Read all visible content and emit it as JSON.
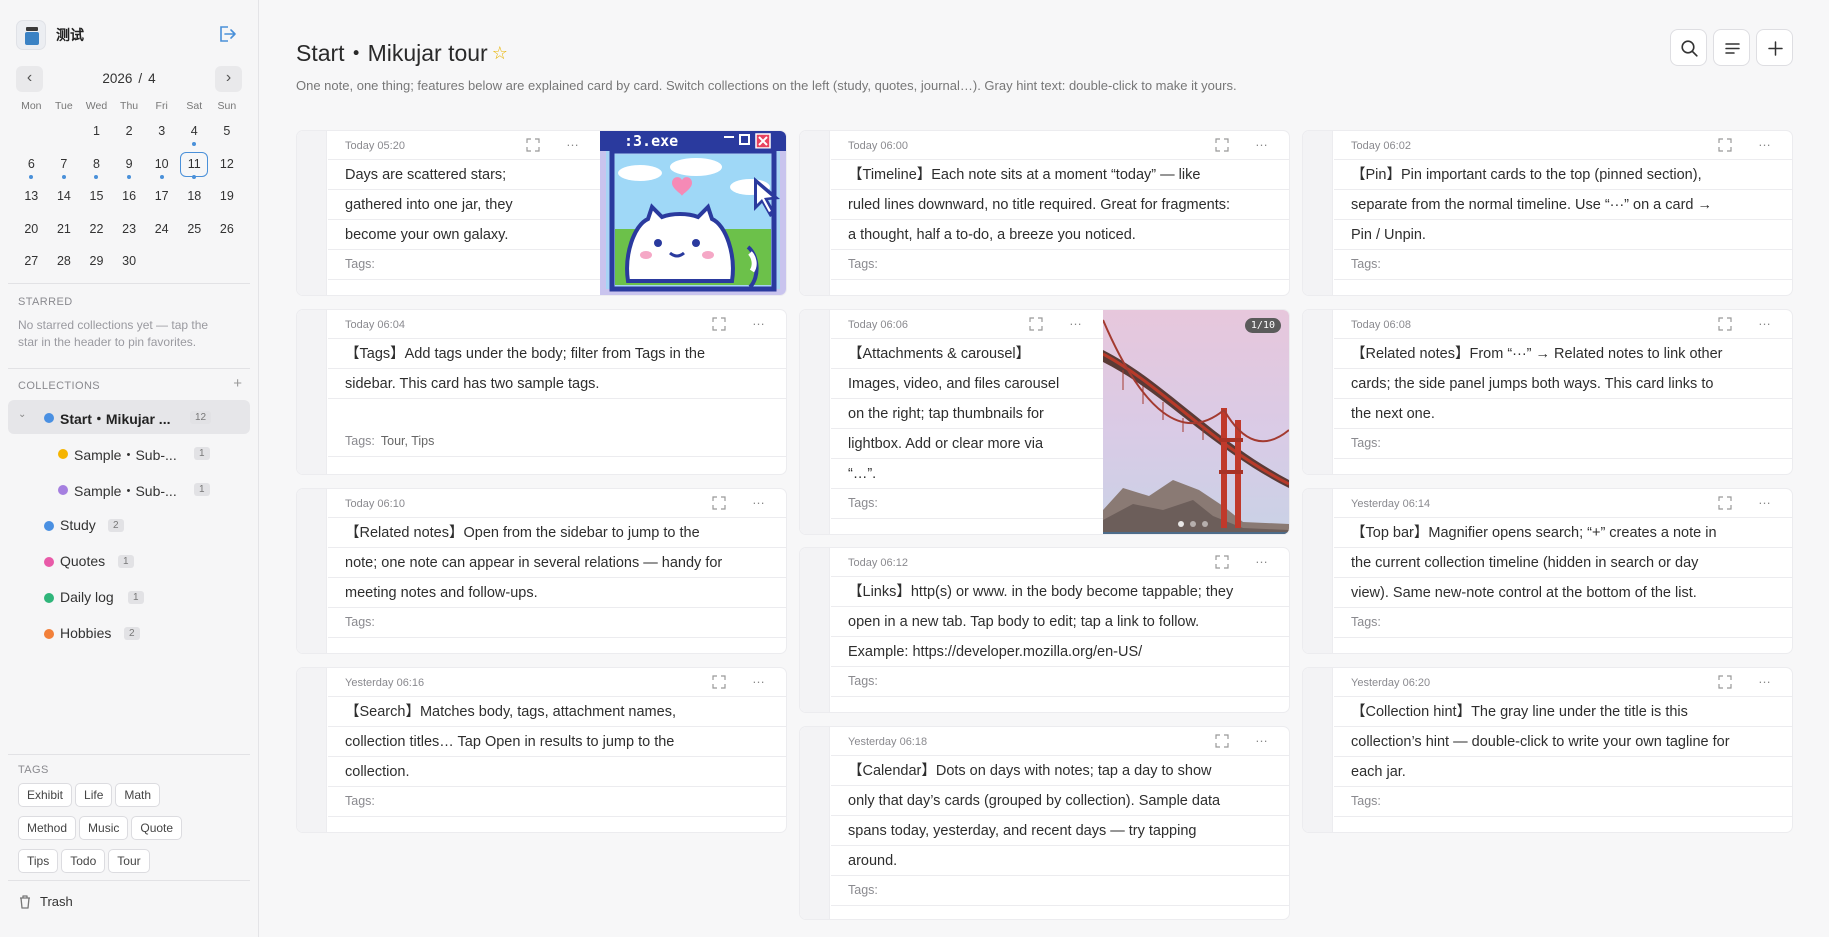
{
  "sidebar": {
    "app_name": "测试",
    "calendar": {
      "year": "2026",
      "separator": "/",
      "month": "4",
      "prev_label": "‹",
      "next_label": "›",
      "weekdays": [
        "Mon",
        "Tue",
        "Wed",
        "Thu",
        "Fri",
        "Sat",
        "Sun"
      ],
      "days": [
        {
          "d": "",
          "dot": false
        },
        {
          "d": "",
          "dot": false
        },
        {
          "d": "1",
          "dot": false
        },
        {
          "d": "2",
          "dot": false
        },
        {
          "d": "3",
          "dot": false
        },
        {
          "d": "4",
          "dot": true
        },
        {
          "d": "5",
          "dot": false
        },
        {
          "d": "6",
          "dot": true
        },
        {
          "d": "7",
          "dot": true
        },
        {
          "d": "8",
          "dot": true
        },
        {
          "d": "9",
          "dot": true
        },
        {
          "d": "10",
          "dot": true
        },
        {
          "d": "11",
          "dot": true,
          "today": true
        },
        {
          "d": "12",
          "dot": false
        },
        {
          "d": "13",
          "dot": false
        },
        {
          "d": "14",
          "dot": false
        },
        {
          "d": "15",
          "dot": false
        },
        {
          "d": "16",
          "dot": false
        },
        {
          "d": "17",
          "dot": false
        },
        {
          "d": "18",
          "dot": false
        },
        {
          "d": "19",
          "dot": false
        },
        {
          "d": "20",
          "dot": false
        },
        {
          "d": "21",
          "dot": false
        },
        {
          "d": "22",
          "dot": false
        },
        {
          "d": "23",
          "dot": false
        },
        {
          "d": "24",
          "dot": false
        },
        {
          "d": "25",
          "dot": false
        },
        {
          "d": "26",
          "dot": false
        },
        {
          "d": "27",
          "dot": false
        },
        {
          "d": "28",
          "dot": false
        },
        {
          "d": "29",
          "dot": false
        },
        {
          "d": "30",
          "dot": false
        }
      ]
    },
    "starred_title": "STARRED",
    "starred_empty": "No starred collections yet — tap the star in the header to pin favorites.",
    "collections_title": "COLLECTIONS",
    "add_collection": "+",
    "collections": [
      {
        "label": "Start・Mikujar ...",
        "count": "12",
        "color": "#4a90e2",
        "active": true,
        "expandable": true
      },
      {
        "label": "Sample・Sub-...",
        "count": "1",
        "color": "#f5b400",
        "child": true
      },
      {
        "label": "Sample・Sub-...",
        "count": "1",
        "color": "#a57fe0",
        "child": true
      },
      {
        "label": "Study",
        "count": "2",
        "color": "#4a90e2"
      },
      {
        "label": "Quotes",
        "count": "1",
        "color": "#e85aa8"
      },
      {
        "label": "Daily log",
        "count": "1",
        "color": "#2fb57a"
      },
      {
        "label": "Hobbies",
        "count": "2",
        "color": "#f2803a"
      }
    ],
    "tags_title": "TAGS",
    "tags": [
      "Exhibit",
      "Life",
      "Math",
      "Method",
      "Music",
      "Quote",
      "Tips",
      "Todo",
      "Tour"
    ],
    "trash_label": "Trash"
  },
  "header": {
    "title": "Start・Mikujar tour",
    "hint": "One note, one thing; features below are explained card by card. Switch collections on the left (study, quotes, journal…). Gray hint text: double-click to make it yours."
  },
  "tags_label": "Tags:",
  "more_label": "…",
  "cards": [
    {
      "time": "Today 05:20",
      "lines": [
        "Days are scattered stars;",
        "gathered into one jar, they",
        "become your own galaxy."
      ],
      "tags": ""
    },
    {
      "time": "Today 06:04",
      "lines": [
        "【Tags】Add tags under the body; filter from Tags in the",
        "sidebar. This card has two sample tags."
      ],
      "tags": "Tour,  Tips"
    },
    {
      "time": "Today 06:10",
      "lines": [
        "【Related notes】Open from the sidebar to jump to the",
        "note; one note can appear in several relations — handy for",
        "meeting notes and follow-ups."
      ],
      "tags": ""
    },
    {
      "time": "Yesterday 06:16",
      "lines": [
        "【Search】Matches body, tags, attachment names,",
        "collection titles… Tap Open in results to jump to the",
        "collection."
      ],
      "tags": ""
    },
    {
      "time": "Today 06:00",
      "lines": [
        "【Timeline】Each note sits at a moment “today” — like",
        "ruled lines downward, no title required. Great for fragments:",
        "a thought, half a to-do, a breeze you noticed."
      ],
      "tags": ""
    },
    {
      "time": "Today 06:06",
      "lines": [
        "【Attachments & carousel】",
        "Images, video, and files carousel",
        "on the right; tap thumbnails for",
        "lightbox. Add or clear more via",
        "“…”."
      ],
      "tags": "",
      "badge": "1/10"
    },
    {
      "time": "Today 06:12",
      "lines": [
        "【Links】http(s) or www. in the body become tappable; they",
        "open in a new tab. Tap body to edit; tap a link to follow.",
        "Example: https://developer.mozilla.org/en-US/"
      ],
      "tags": ""
    },
    {
      "time": "Yesterday 06:18",
      "lines": [
        "【Calendar】Dots on days with notes; tap a day to show",
        "only that day’s cards (grouped by collection). Sample data",
        "spans today, yesterday, and recent days — try tapping",
        "around."
      ],
      "tags": ""
    },
    {
      "time": "Today 06:02",
      "lines": [
        "【Pin】Pin important cards to the top (pinned section),",
        "separate from the normal timeline. Use “···” on a card →",
        "Pin / Unpin."
      ],
      "tags": ""
    },
    {
      "time": "Today 06:08",
      "lines": [
        "【Related notes】From “···” → Related notes to link other",
        "cards; the side panel jumps both ways. This card links to",
        "the next one."
      ],
      "tags": ""
    },
    {
      "time": "Yesterday 06:14",
      "lines": [
        "【Top bar】Magnifier opens search; “+” creates a note in",
        "the current collection timeline (hidden in search or day",
        "view). Same new-note control at the bottom of the list."
      ],
      "tags": ""
    },
    {
      "time": "Yesterday 06:20",
      "lines": [
        "【Collection hint】The gray line under the title is this",
        "collection’s hint — double-click to write your own tagline for",
        "each jar."
      ],
      "tags": ""
    }
  ]
}
